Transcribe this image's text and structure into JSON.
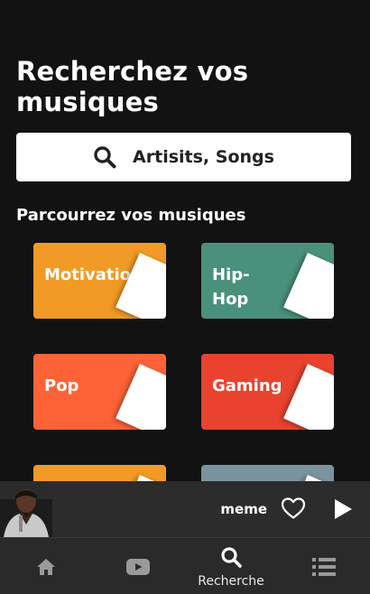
{
  "header": {
    "title": "Recherchez vos musiques"
  },
  "search": {
    "placeholder": "Artisits, Songs",
    "icon": "search-icon"
  },
  "browse": {
    "title": "Parcourrez vos musiques",
    "genres": [
      {
        "label": "Motivation",
        "color": "#f29a26"
      },
      {
        "label": "Hip-Hop",
        "color": "#4a917b"
      },
      {
        "label": "Pop",
        "color": "#fd6337"
      },
      {
        "label": "Gaming",
        "color": "#e9432f"
      },
      {
        "label": "",
        "color": "#f29a26"
      },
      {
        "label": "",
        "color": "#7b939f"
      }
    ]
  },
  "player": {
    "track_title": "meme",
    "cover_icon": "album-cover",
    "like_icon": "heart-icon",
    "play_icon": "play-icon"
  },
  "nav": {
    "items": [
      {
        "icon": "home-icon",
        "label": ""
      },
      {
        "icon": "youtube-icon",
        "label": ""
      },
      {
        "icon": "search-icon",
        "label": "Recherche"
      },
      {
        "icon": "list-icon",
        "label": ""
      }
    ]
  },
  "colors": {
    "background": "#121212",
    "player_bar": "#2c2c2c",
    "nav_bar": "#2a2a2a"
  }
}
